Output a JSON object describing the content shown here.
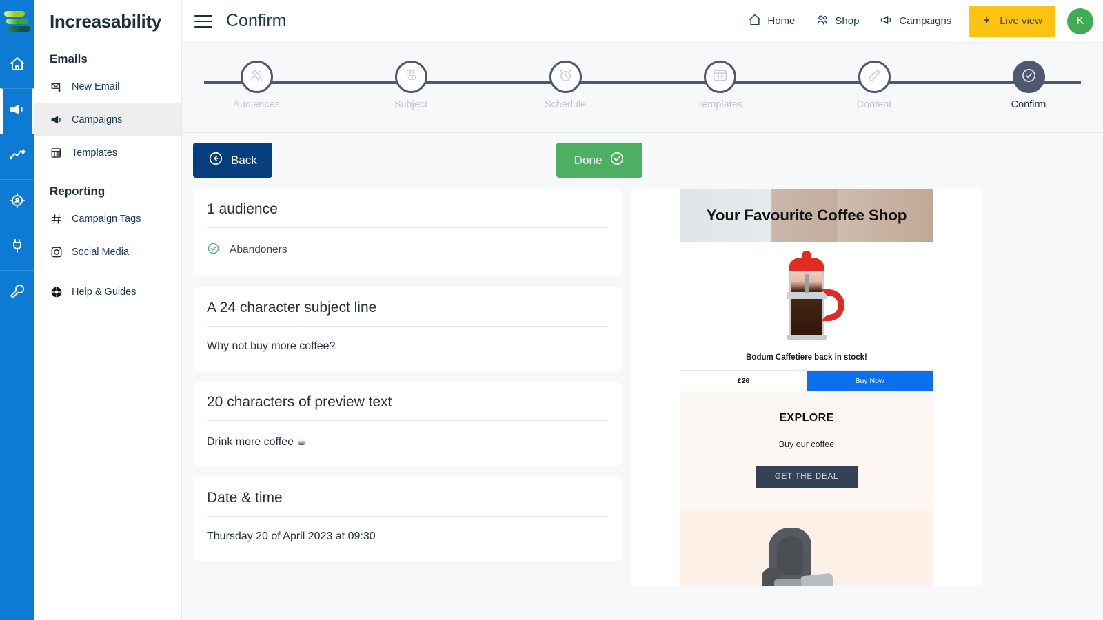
{
  "brand": {
    "name": "Increasability"
  },
  "rail": {
    "logo_name": "increasability-logo",
    "items": [
      {
        "name": "home",
        "icon": "home-icon",
        "active": false
      },
      {
        "name": "campaigns",
        "icon": "megaphone-icon",
        "active": true
      },
      {
        "name": "analytics",
        "icon": "line-chart-icon",
        "active": false
      },
      {
        "name": "audiences",
        "icon": "target-person-icon",
        "active": false
      },
      {
        "name": "integrations",
        "icon": "plug-icon",
        "active": false
      },
      {
        "name": "settings",
        "icon": "wrench-icon",
        "active": false
      }
    ]
  },
  "sidebar": {
    "sections": [
      {
        "title": "Emails",
        "items": [
          {
            "label": "New Email",
            "icon": "envelope-plus-icon",
            "active": false
          },
          {
            "label": "Campaigns",
            "icon": "megaphone-icon",
            "active": true
          },
          {
            "label": "Templates",
            "icon": "template-grid-icon",
            "active": false
          }
        ]
      },
      {
        "title": "Reporting",
        "items": [
          {
            "label": "Campaign Tags",
            "icon": "hash-icon",
            "active": false
          },
          {
            "label": "Social Media",
            "icon": "instagram-icon",
            "active": false
          },
          {
            "label": "Help & Guides",
            "icon": "lifebuoy-icon",
            "active": false
          }
        ]
      }
    ]
  },
  "topbar": {
    "menu_icon": "hamburger-icon",
    "title": "Confirm",
    "nav": [
      {
        "label": "Home",
        "icon": "home-icon"
      },
      {
        "label": "Shop",
        "icon": "people-icon"
      },
      {
        "label": "Campaigns",
        "icon": "megaphone-icon"
      }
    ],
    "live_view": {
      "label": "Live view",
      "icon": "bolt-icon",
      "color": "#fcc312"
    },
    "avatar": {
      "initial": "K",
      "color": "#41aa55"
    }
  },
  "stepper": {
    "steps": [
      {
        "label": "Audiences",
        "icon": "people-icon",
        "active": false
      },
      {
        "label": "Subject",
        "icon": "subject-icon",
        "active": false
      },
      {
        "label": "Schedule",
        "icon": "alarm-clock-icon",
        "active": false
      },
      {
        "label": "Templates",
        "icon": "code-window-icon",
        "active": false
      },
      {
        "label": "Content",
        "icon": "pencil-icon",
        "active": false
      },
      {
        "label": "Confirm",
        "icon": "check-circle-icon",
        "active": true
      }
    ],
    "line_color": "#4f5870"
  },
  "actions": {
    "back": {
      "label": "Back",
      "icon": "arrow-left-circle-icon",
      "color": "#073f7e"
    },
    "done": {
      "label": "Done",
      "icon": "check-circle-icon",
      "color": "#4caf62"
    }
  },
  "cards": {
    "audience": {
      "heading": "1 audience",
      "items": [
        {
          "label": "Abandoners",
          "icon": "check-circle-icon"
        }
      ]
    },
    "subject": {
      "heading": "A 24 character subject line",
      "value": "Why not buy more coffee?"
    },
    "preview_text": {
      "heading": "20 characters of preview text",
      "value": "Drink more coffee ☕"
    },
    "datetime": {
      "heading": "Date & time",
      "value": "Thursday 20 of April 2023 at 09:30"
    }
  },
  "email_preview": {
    "hero_title": "Your Favourite Coffee Shop",
    "product_image": "french-press-image",
    "product_caption": "Bodum Caffetiere back in stock!",
    "price": "£26",
    "buy_label": "Buy Now",
    "buy_color": "#0b70f0",
    "explore_heading": "EXPLORE",
    "explore_sub": "Buy our coffee",
    "explore_button": "GET THE DEAL",
    "explore_button_color": "#344256",
    "chair_image": "armchair-image"
  }
}
